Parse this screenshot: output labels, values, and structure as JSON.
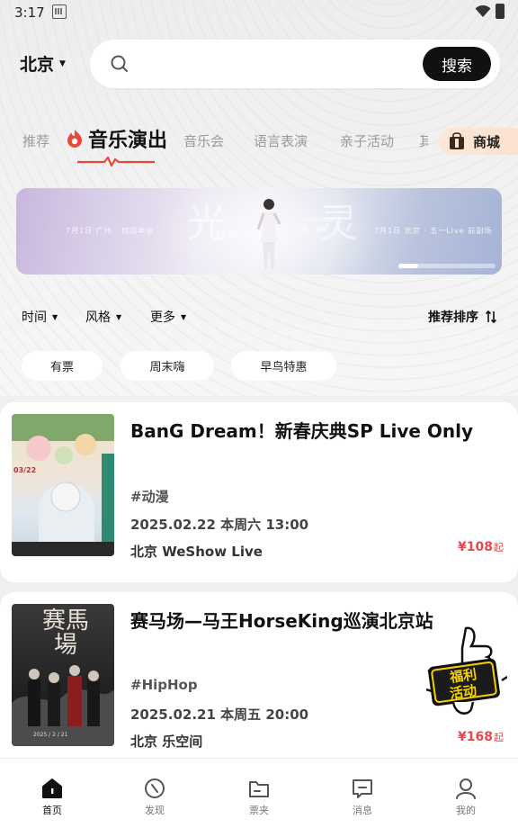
{
  "status_bar": {
    "time": "3:17"
  },
  "header": {
    "city": "北京",
    "search_placeholder": "",
    "search_button": "搜索"
  },
  "tabs": {
    "items": [
      "推荐",
      "音乐演出",
      "音乐会",
      "语言表演",
      "亲子活动",
      "其"
    ],
    "active": "音乐演出",
    "shop_label": "商城"
  },
  "banner": {
    "big_text_left": "光",
    "big_text_right": "灵",
    "small_text_left": "7月1日 广州 · 时尚年会",
    "small_text_right": "7月1日 北京 · 五一Live 前副场",
    "mid_text": "Light it up 北京 · 国际",
    "mid_text2": "国 · 光亮",
    "carousel_progress": 0.2
  },
  "filters": {
    "items": [
      "时间",
      "风格",
      "更多"
    ],
    "sort_label": "推荐排序"
  },
  "chips": [
    "有票",
    "周末嗨",
    "早鸟特惠"
  ],
  "events": [
    {
      "title": "BanG Dream！新春庆典SP Live Only",
      "tag": "#动漫",
      "date": "2025.02.22 本周六 13:00",
      "venue": "北京 WeShow Live",
      "price": "¥108",
      "price_suffix": "起"
    },
    {
      "title": "赛马场—马王HorseKing巡演北京站",
      "tag": "#HipHop",
      "date": "2025.02.21 本周五 20:00",
      "venue": "北京 乐空间",
      "price": "¥168",
      "price_suffix": "起"
    }
  ],
  "promo_badge": {
    "line1": "福利",
    "line2": "活动"
  },
  "poster_text": {
    "event1_date": "03/22",
    "event2_title": "赛馬場",
    "event2_date": "2025 / 2 / 21"
  },
  "bottom_nav": [
    {
      "label": "首页",
      "icon": "home-icon",
      "active": true
    },
    {
      "label": "发现",
      "icon": "compass-icon",
      "active": false
    },
    {
      "label": "票夹",
      "icon": "ticket-folder-icon",
      "active": false
    },
    {
      "label": "消息",
      "icon": "message-icon",
      "active": false
    },
    {
      "label": "我的",
      "icon": "profile-icon",
      "active": false
    }
  ],
  "colors": {
    "accent_red": "#e5484d",
    "search_button_bg": "#111111",
    "shop_pill_bg": "#fde6d5"
  }
}
